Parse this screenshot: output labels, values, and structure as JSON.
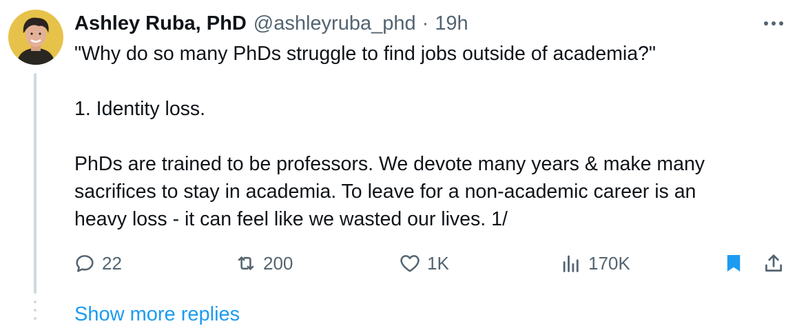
{
  "tweet": {
    "author_name": "Ashley Ruba, PhD",
    "handle": "@ashleyruba_phd",
    "separator": "·",
    "time": "19h",
    "text_lines": [
      "\"Why do so many PhDs struggle to find jobs outside of academia?\"",
      "1. Identity loss.",
      "PhDs are trained to be professors. We devote many years & make many",
      "sacrifices to stay in academia. To leave for a non-academic career is an",
      "heavy loss - it can feel like we wasted our lives. 1/"
    ]
  },
  "actions": {
    "replies": "22",
    "retweets": "200",
    "likes": "1K",
    "views": "170K"
  },
  "icons": {
    "more": "more-horizontal-icon",
    "reply": "reply-icon",
    "retweet": "retweet-icon",
    "like": "heart-icon",
    "views": "analytics-icon",
    "bookmark": "bookmark-icon",
    "share": "share-icon"
  },
  "colors": {
    "accent": "#1d9bf0",
    "secondary_text": "#536471",
    "thread_line": "#cfd9de"
  },
  "footer": {
    "show_more_replies": "Show more replies"
  }
}
